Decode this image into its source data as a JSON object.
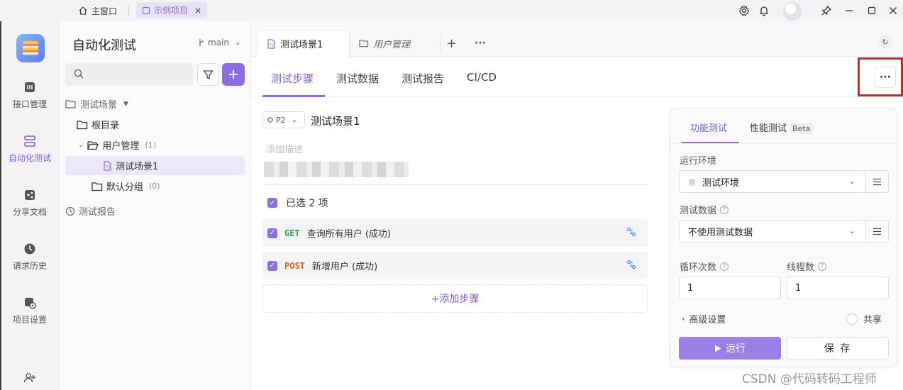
{
  "titlebar": {
    "home_label": "主窗口",
    "project_tab_label": "示例项目",
    "close_symbol": "×"
  },
  "rail": {
    "items": [
      {
        "label": "接口管理",
        "icon": "api-icon"
      },
      {
        "label": "自动化测试",
        "icon": "automation-icon",
        "active": true
      },
      {
        "label": "分享文档",
        "icon": "share-doc-icon"
      },
      {
        "label": "请求历史",
        "icon": "history-icon"
      },
      {
        "label": "项目设置",
        "icon": "settings-icon"
      }
    ]
  },
  "side": {
    "title": "自动化测试",
    "branch": "main",
    "tree": {
      "root_section": "测试场景",
      "root_dir": "根目录",
      "folder_user": "用户管理",
      "folder_user_count": "(1)",
      "scenario": "测试场景1",
      "folder_default": "默认分组",
      "folder_default_count": "(0)",
      "reports": "测试报告"
    }
  },
  "tabs": {
    "active_tab": "测试场景1",
    "second_tab": "用户管理",
    "add": "+",
    "more": "···"
  },
  "subtabs": {
    "steps": "测试步骤",
    "data": "测试数据",
    "report": "测试报告",
    "cicd": "CI/CD",
    "more": "···"
  },
  "scenario": {
    "priority": "P2",
    "name": "测试场景1",
    "desc_placeholder": "添加描述",
    "selected_text": "已选 2 项",
    "steps": [
      {
        "method": "GET",
        "method_color": "#2e9e5b",
        "name": "查询所有用户 (成功)"
      },
      {
        "method": "POST",
        "method_color": "#e0632a",
        "name": "新增用户 (成功)"
      }
    ],
    "add_step": "+添加步骤"
  },
  "run_panel": {
    "tab_functional": "功能测试",
    "tab_performance": "性能测试",
    "beta": "Beta",
    "env_label": "运行环境",
    "env_tag": "测",
    "env_value": "测试环境",
    "data_label": "测试数据",
    "data_value": "不使用测试数据",
    "loop_label": "循环次数",
    "loop_value": "1",
    "thread_label": "线程数",
    "thread_value": "1",
    "advanced": "高级设置",
    "share": "共享",
    "run": "运行",
    "save": "保 存"
  },
  "watermark": "CSDN @代码转码工程师",
  "colors": {
    "accent": "#8b6fe0",
    "highlight_box": "#e02020"
  }
}
